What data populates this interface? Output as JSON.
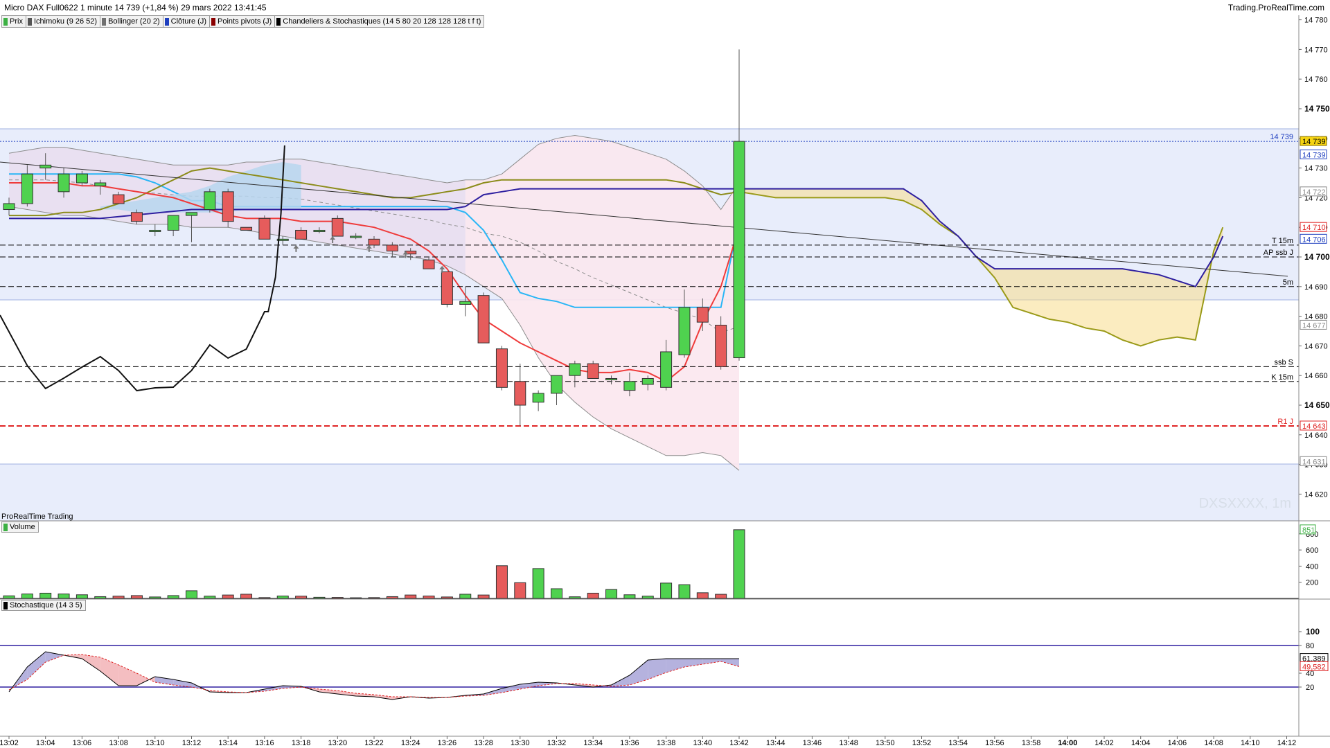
{
  "header": {
    "title": "Micro DAX Full0622 1 minute 14 739 (+1,84 %) 29 mars 2022 13:41:45",
    "site": "Trading.ProRealTime.com"
  },
  "legend": [
    {
      "label": "Prix",
      "color": "#3cb043"
    },
    {
      "label": "Ichimoku (9 26 52)",
      "color": "#555555"
    },
    {
      "label": "Bollinger (20 2)",
      "color": "#707070"
    },
    {
      "label": "Clôture (J)",
      "color": "#1f3fbf"
    },
    {
      "label": "Points pivots (J)",
      "color": "#8b0000"
    },
    {
      "label": "Chandeliers & Stochastiques (14 5 80 20 128 128 128 t f t)",
      "color": "#000000"
    }
  ],
  "price_axis": {
    "ticks": [
      14780,
      14770,
      14760,
      14750,
      14740,
      14730,
      14720,
      14710,
      14700,
      14690,
      14680,
      14670,
      14660,
      14650,
      14640,
      14630,
      14620
    ],
    "bold": [
      14750,
      14700,
      14650
    ],
    "tags": [
      {
        "text": "14 739",
        "value": 14739,
        "bg": "#f5d312",
        "fg": "#000000",
        "border": "#8a7400"
      },
      {
        "text": "14 739",
        "value": 14734.5,
        "bg": "#ffffff",
        "fg": "#1f3fbf",
        "border": "#1f3fbf"
      },
      {
        "text": "14 722",
        "value": 14722,
        "bg": "#ffffff",
        "fg": "#8a8a8a",
        "border": "#8a8a8a"
      },
      {
        "text": "14 710",
        "value": 14710,
        "bg": "#ffffff",
        "fg": "#e02424",
        "border": "#e02424"
      },
      {
        "text": "14 706",
        "value": 14706,
        "bg": "#ffffff",
        "fg": "#1f3fbf",
        "border": "#1f3fbf"
      },
      {
        "text": "14 677",
        "value": 14677,
        "bg": "#ffffff",
        "fg": "#8a8a8a",
        "border": "#8a8a8a"
      },
      {
        "text": "14 643",
        "value": 14643,
        "bg": "#ffffff",
        "fg": "#e02424",
        "border": "#e02424"
      },
      {
        "text": "14 631",
        "value": 14631,
        "bg": "#ffffff",
        "fg": "#8a8a8a",
        "border": "#8a8a8a"
      }
    ]
  },
  "price_lines": [
    {
      "label": "14 739",
      "value": 14739,
      "style": "dotted",
      "color": "#1f3fbf"
    },
    {
      "label": "T 15m",
      "value": 14704,
      "style": "dashed",
      "color": "#000000"
    },
    {
      "label": "AP ssb J",
      "value": 14700,
      "style": "dashed",
      "color": "#000000"
    },
    {
      "label": "5m",
      "value": 14690,
      "style": "dashed",
      "color": "#000000"
    },
    {
      "label": "ssb S",
      "value": 14663,
      "style": "dashed",
      "color": "#000000"
    },
    {
      "label": "K 15m",
      "value": 14658,
      "style": "dashed",
      "color": "#000000"
    },
    {
      "label": "R1 J",
      "value": 14643,
      "style": "dashed",
      "color": "#e02424"
    }
  ],
  "watermark": "DXSXXXX, 1m",
  "panels": {
    "source": "ProRealTime Trading",
    "volume_label": "Volume",
    "volume_last": "851",
    "stoch_label": "Stochastique (14 3 5)",
    "stoch_k_last": "61,389",
    "stoch_d_last": "49,582"
  },
  "volume_axis": {
    "ticks": [
      800,
      600,
      400,
      200
    ]
  },
  "stoch_axis": {
    "ticks": [
      100,
      80,
      40,
      20
    ],
    "upper": 80,
    "lower": 20
  },
  "time_axis": {
    "labels": [
      "13:02",
      "13:04",
      "13:06",
      "13:08",
      "13:10",
      "13:12",
      "13:14",
      "13:16",
      "13:18",
      "13:20",
      "13:22",
      "13:24",
      "13:26",
      "13:28",
      "13:30",
      "13:32",
      "13:34",
      "13:36",
      "13:38",
      "13:40",
      "13:42",
      "13:44",
      "13:46",
      "13:48",
      "13:50",
      "13:52",
      "13:54",
      "13:56",
      "13:58",
      "14:00",
      "14:02",
      "14:04",
      "14:06",
      "14:08",
      "14:10",
      "14:12"
    ],
    "bold": "14:00"
  },
  "chart_data": {
    "type": "candlestick",
    "candles": [
      {
        "t": "13:02",
        "o": 14716,
        "h": 14720,
        "l": 14714,
        "c": 14718
      },
      {
        "t": "13:03",
        "o": 14718,
        "h": 14731,
        "l": 14717,
        "c": 14728
      },
      {
        "t": "13:04",
        "o": 14730,
        "h": 14735,
        "l": 14726,
        "c": 14731
      },
      {
        "t": "13:05",
        "o": 14722,
        "h": 14730,
        "l": 14720,
        "c": 14728
      },
      {
        "t": "13:06",
        "o": 14725,
        "h": 14729,
        "l": 14724,
        "c": 14728
      },
      {
        "t": "13:07",
        "o": 14724,
        "h": 14726,
        "l": 14721,
        "c": 14725
      },
      {
        "t": "13:08",
        "o": 14721,
        "h": 14722,
        "l": 14718,
        "c": 14718
      },
      {
        "t": "13:09",
        "o": 14715,
        "h": 14716,
        "l": 14711,
        "c": 14712
      },
      {
        "t": "13:10",
        "o": 14709,
        "h": 14711,
        "l": 14707,
        "c": 14709
      },
      {
        "t": "13:11",
        "o": 14709,
        "h": 14714,
        "l": 14707,
        "c": 14714
      },
      {
        "t": "13:12",
        "o": 14714,
        "h": 14715,
        "l": 14705,
        "c": 14715
      },
      {
        "t": "13:13",
        "o": 14716,
        "h": 14723,
        "l": 14715,
        "c": 14722
      },
      {
        "t": "13:14",
        "o": 14722,
        "h": 14723,
        "l": 14710,
        "c": 14712
      },
      {
        "t": "13:15",
        "o": 14710,
        "h": 14710,
        "l": 14709,
        "c": 14709
      },
      {
        "t": "13:16",
        "o": 14713,
        "h": 14714,
        "l": 14706,
        "c": 14706
      },
      {
        "t": "13:17",
        "o": 14706,
        "h": 14707,
        "l": 14704,
        "c": 14706
      },
      {
        "t": "13:18",
        "o": 14709,
        "h": 14710,
        "l": 14706,
        "c": 14706
      },
      {
        "t": "13:19",
        "o": 14709,
        "h": 14710,
        "l": 14708,
        "c": 14709
      },
      {
        "t": "13:20",
        "o": 14713,
        "h": 14714,
        "l": 14707,
        "c": 14707
      },
      {
        "t": "13:21",
        "o": 14707,
        "h": 14708,
        "l": 14706,
        "c": 14707
      },
      {
        "t": "13:22",
        "o": 14706,
        "h": 14707,
        "l": 14703,
        "c": 14704
      },
      {
        "t": "13:23",
        "o": 14704,
        "h": 14705,
        "l": 14700,
        "c": 14702
      },
      {
        "t": "13:24",
        "o": 14702,
        "h": 14703,
        "l": 14699,
        "c": 14701
      },
      {
        "t": "13:25",
        "o": 14699,
        "h": 14700,
        "l": 14696,
        "c": 14696
      },
      {
        "t": "13:26",
        "o": 14695,
        "h": 14695,
        "l": 14683,
        "c": 14684
      },
      {
        "t": "13:27",
        "o": 14684,
        "h": 14690,
        "l": 14680,
        "c": 14685
      },
      {
        "t": "13:28",
        "o": 14687,
        "h": 14688,
        "l": 14671,
        "c": 14671
      },
      {
        "t": "13:29",
        "o": 14669,
        "h": 14670,
        "l": 14655,
        "c": 14656
      },
      {
        "t": "13:30",
        "o": 14658,
        "h": 14664,
        "l": 14643,
        "c": 14650
      },
      {
        "t": "13:31",
        "o": 14651,
        "h": 14655,
        "l": 14648,
        "c": 14654
      },
      {
        "t": "13:32",
        "o": 14654,
        "h": 14660,
        "l": 14650,
        "c": 14660
      },
      {
        "t": "13:33",
        "o": 14660,
        "h": 14665,
        "l": 14656,
        "c": 14664
      },
      {
        "t": "13:34",
        "o": 14664,
        "h": 14665,
        "l": 14659,
        "c": 14659
      },
      {
        "t": "13:35",
        "o": 14659,
        "h": 14660,
        "l": 14657,
        "c": 14659
      },
      {
        "t": "13:36",
        "o": 14655,
        "h": 14661,
        "l": 14653,
        "c": 14658
      },
      {
        "t": "13:37",
        "o": 14657,
        "h": 14660,
        "l": 14655,
        "c": 14659
      },
      {
        "t": "13:38",
        "o": 14656,
        "h": 14672,
        "l": 14655,
        "c": 14668
      },
      {
        "t": "13:39",
        "o": 14667,
        "h": 14689,
        "l": 14666,
        "c": 14683
      },
      {
        "t": "13:40",
        "o": 14683,
        "h": 14686,
        "l": 14675,
        "c": 14678
      },
      {
        "t": "13:41",
        "o": 14677,
        "h": 14680,
        "l": 14662,
        "c": 14663
      },
      {
        "t": "13:42",
        "o": 14666,
        "h": 14770,
        "l": 14665,
        "c": 14739
      }
    ],
    "volume": [
      32,
      55,
      65,
      55,
      45,
      22,
      28,
      35,
      18,
      35,
      95,
      28,
      42,
      52,
      10,
      30,
      28,
      14,
      12,
      8,
      10,
      22,
      42,
      30,
      18,
      52,
      42,
      405,
      195,
      370,
      120,
      20,
      65,
      110,
      45,
      28,
      190,
      170,
      70,
      51,
      851
    ],
    "stoch_k": [
      13,
      49,
      71,
      66,
      61,
      43,
      22,
      22,
      35,
      31,
      26,
      13,
      12,
      12,
      17,
      22,
      21,
      13,
      10,
      7,
      6,
      2,
      6,
      4,
      5,
      8,
      10,
      18,
      24,
      27,
      26,
      23,
      20,
      23,
      37,
      59,
      61,
      61,
      61,
      61,
      61
    ],
    "stoch_d": [
      16,
      31,
      56,
      66,
      67,
      63,
      52,
      40,
      27,
      23,
      20,
      15,
      13,
      12,
      14,
      18,
      20,
      17,
      15,
      11,
      9,
      6,
      6,
      5,
      5,
      7,
      8,
      12,
      17,
      22,
      25,
      25,
      23,
      21,
      23,
      31,
      41,
      49,
      53,
      57,
      49.6
    ]
  }
}
